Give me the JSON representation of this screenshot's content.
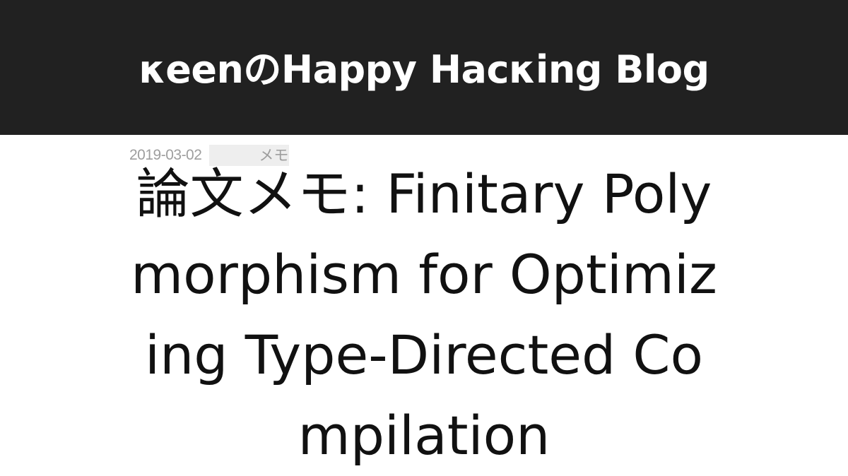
{
  "header": {
    "site_title": "κeenのHappy Hacκing Blog",
    "background_color": "#212121"
  },
  "post": {
    "date": "2019-03-02",
    "category": "メモ",
    "title": "論文メモ: Finitary Polymorphism for Optimizing Type-Directed Compilation"
  }
}
